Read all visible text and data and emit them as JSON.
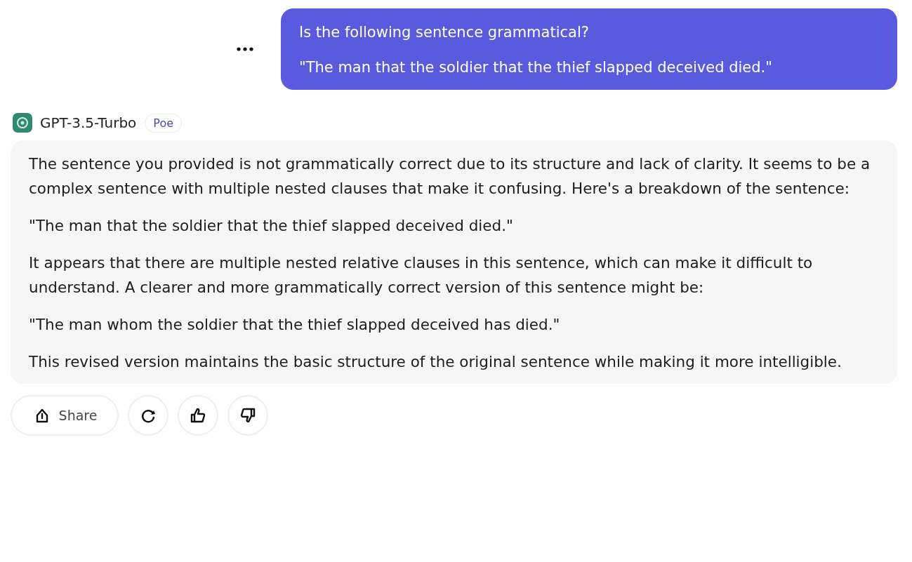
{
  "user_message": {
    "lines": [
      "Is the following sentence grammatical?",
      "\"The man that the soldier that the thief slapped deceived died.\""
    ]
  },
  "bot": {
    "name": "GPT-3.5-Turbo",
    "badge": "Poe"
  },
  "response": {
    "paragraphs": [
      "The sentence you provided is not grammatically correct due to its structure and lack of clarity. It seems to be a complex sentence with multiple nested clauses that make it confusing. Here's a breakdown of the sentence:",
      "\"The man that the soldier that the thief slapped deceived died.\"",
      "It appears that there are multiple nested relative clauses in this sentence, which can make it difficult to understand. A clearer and more grammatically correct version of this sentence might be:",
      "\"The man whom the soldier that the thief slapped deceived has died.\"",
      "This revised version maintains the basic structure of the original sentence while making it more intelligible."
    ]
  },
  "actions": [
    {
      "kind": "share",
      "label": "Share"
    },
    {
      "kind": "retry"
    },
    {
      "kind": "like"
    },
    {
      "kind": "dislike"
    }
  ]
}
